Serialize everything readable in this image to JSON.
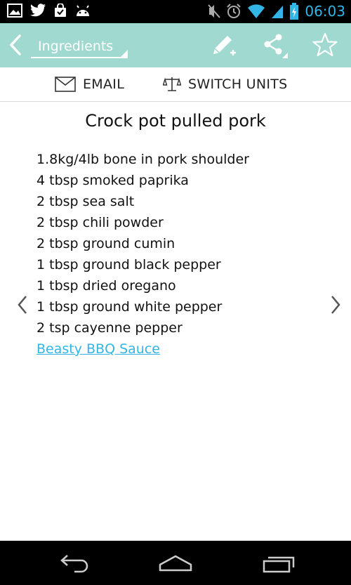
{
  "status_bar": {
    "time": "06:03",
    "left_icons": [
      "gallery-icon",
      "twitter-icon",
      "shopping-bag-icon",
      "android-icon"
    ],
    "right_icons": [
      "mute-icon",
      "alarm-icon",
      "wifi-icon",
      "signal-icon",
      "battery-charging-icon"
    ]
  },
  "action_bar": {
    "spinner_label": "Ingredients",
    "accent": "#9fd9cf"
  },
  "toolbar": {
    "email_label": "EMAIL",
    "units_label": "SWITCH UNITS"
  },
  "recipe": {
    "title": "Crock pot pulled pork",
    "ingredients": [
      "1.8kg/4lb bone in pork shoulder",
      "4 tbsp smoked paprika",
      "2 tbsp sea salt",
      "2 tbsp chili powder",
      "2 tbsp ground cumin",
      "1 tbsp ground black pepper",
      "1 tbsp dried oregano",
      "1 tbsp ground white pepper",
      "2 tsp cayenne pepper"
    ],
    "link_label": "Beasty BBQ Sauce ",
    "link_color": "#33b5e5"
  }
}
